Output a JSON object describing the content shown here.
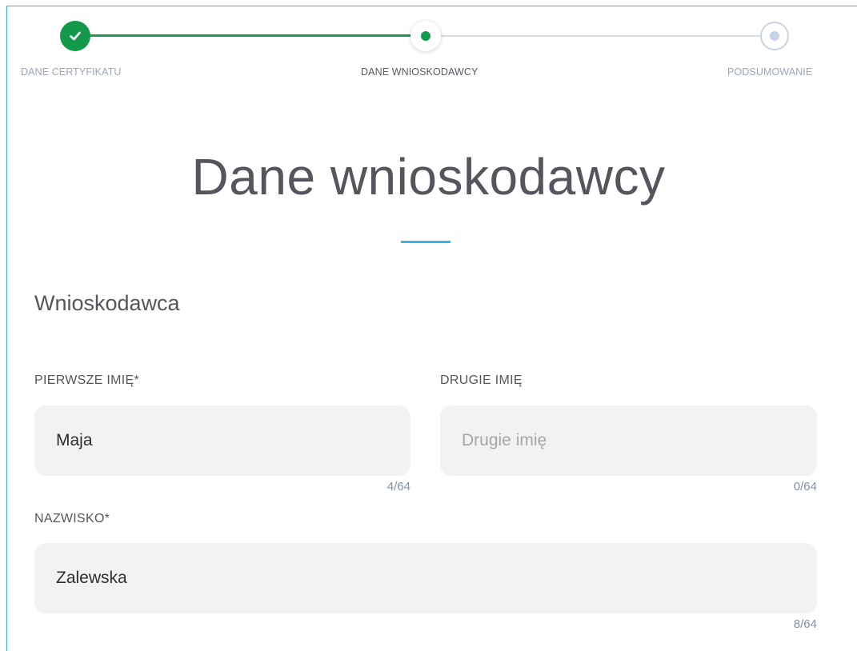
{
  "stepper": {
    "steps": [
      {
        "label": "DANE CERTYFIKATU",
        "state": "done"
      },
      {
        "label": "DANE WNIOSKODAWCY",
        "state": "active"
      },
      {
        "label": "PODSUMOWANIE",
        "state": "todo"
      }
    ],
    "colors": {
      "done": "#129a4a",
      "todo": "#c8d3e6",
      "accent": "#3ab4e0"
    }
  },
  "page": {
    "title": "Dane wnioskodawcy",
    "section_title": "Wnioskodawca"
  },
  "form": {
    "first_name": {
      "label": "PIERWSZE IMIĘ*",
      "value": "Maja",
      "placeholder": "",
      "counter": "4/64"
    },
    "second_name": {
      "label": "DRUGIE IMIĘ",
      "value": "",
      "placeholder": "Drugie imię",
      "counter": "0/64"
    },
    "surname": {
      "label": "NAZWISKO*",
      "value": "Zalewska",
      "placeholder": "",
      "counter": "8/64"
    }
  }
}
